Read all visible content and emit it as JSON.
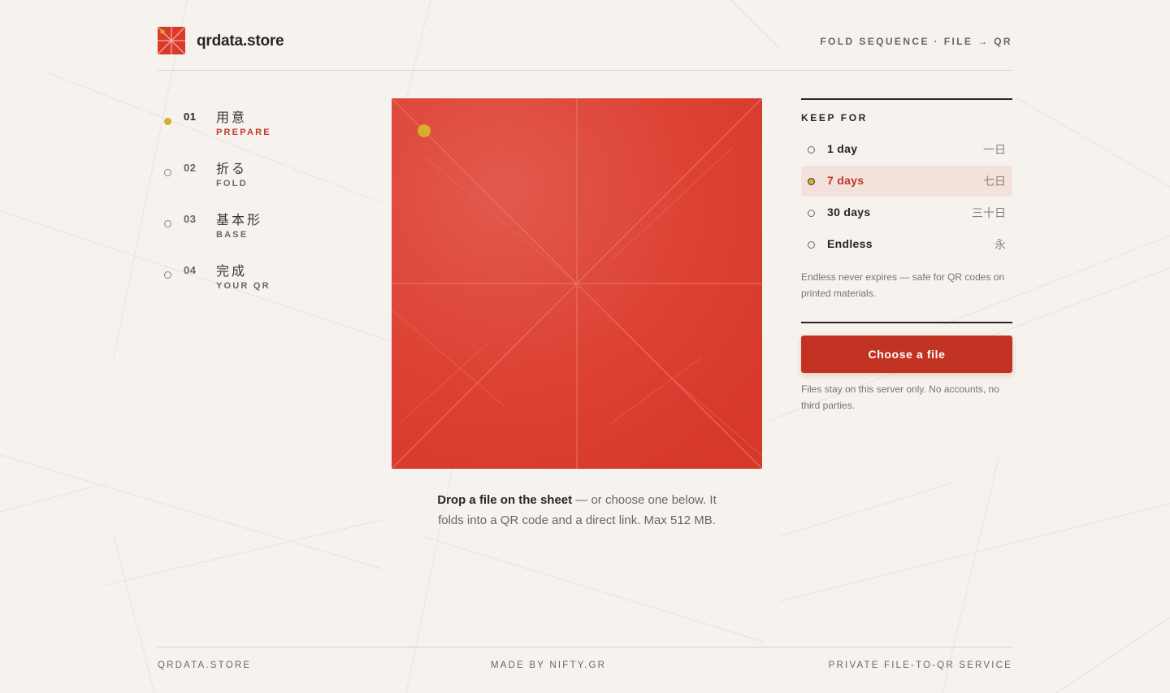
{
  "brand": {
    "name": "qrdata.store"
  },
  "header": {
    "tagline": "FOLD SEQUENCE · FILE → QR"
  },
  "steps": [
    {
      "num": "01",
      "jp": "用意",
      "en": "PREPARE",
      "active": true
    },
    {
      "num": "02",
      "jp": "折る",
      "en": "FOLD",
      "active": false
    },
    {
      "num": "03",
      "jp": "基本形",
      "en": "BASE",
      "active": false
    },
    {
      "num": "04",
      "jp": "完成",
      "en": "YOUR QR",
      "active": false
    }
  ],
  "sheet": {
    "color": "#dc4133",
    "marker_color": "#d4ae2c"
  },
  "caption": {
    "strong": "Drop a file on the sheet",
    "rest": " — or choose one below. It folds into a QR code and a direct link. Max 512 MB."
  },
  "keep": {
    "title": "KEEP FOR",
    "options": [
      {
        "label": "1 day",
        "kanji": "一日",
        "selected": false
      },
      {
        "label": "7 days",
        "kanji": "七日",
        "selected": true
      },
      {
        "label": "30 days",
        "kanji": "三十日",
        "selected": false
      },
      {
        "label": "Endless",
        "kanji": "永",
        "selected": false
      }
    ],
    "note": "Endless never expires — safe for QR codes on printed materials."
  },
  "cta": {
    "label": "Choose a file",
    "note": "Files stay on this server only. No accounts, no third parties."
  },
  "footer": {
    "left": "QRDATA.STORE",
    "middle": "MADE BY NIFTY.GR",
    "right": "PRIVATE FILE-TO-QR SERVICE"
  },
  "colors": {
    "accent": "#c23222",
    "gold": "#d4ae2c",
    "background": "#f6f3ee"
  }
}
